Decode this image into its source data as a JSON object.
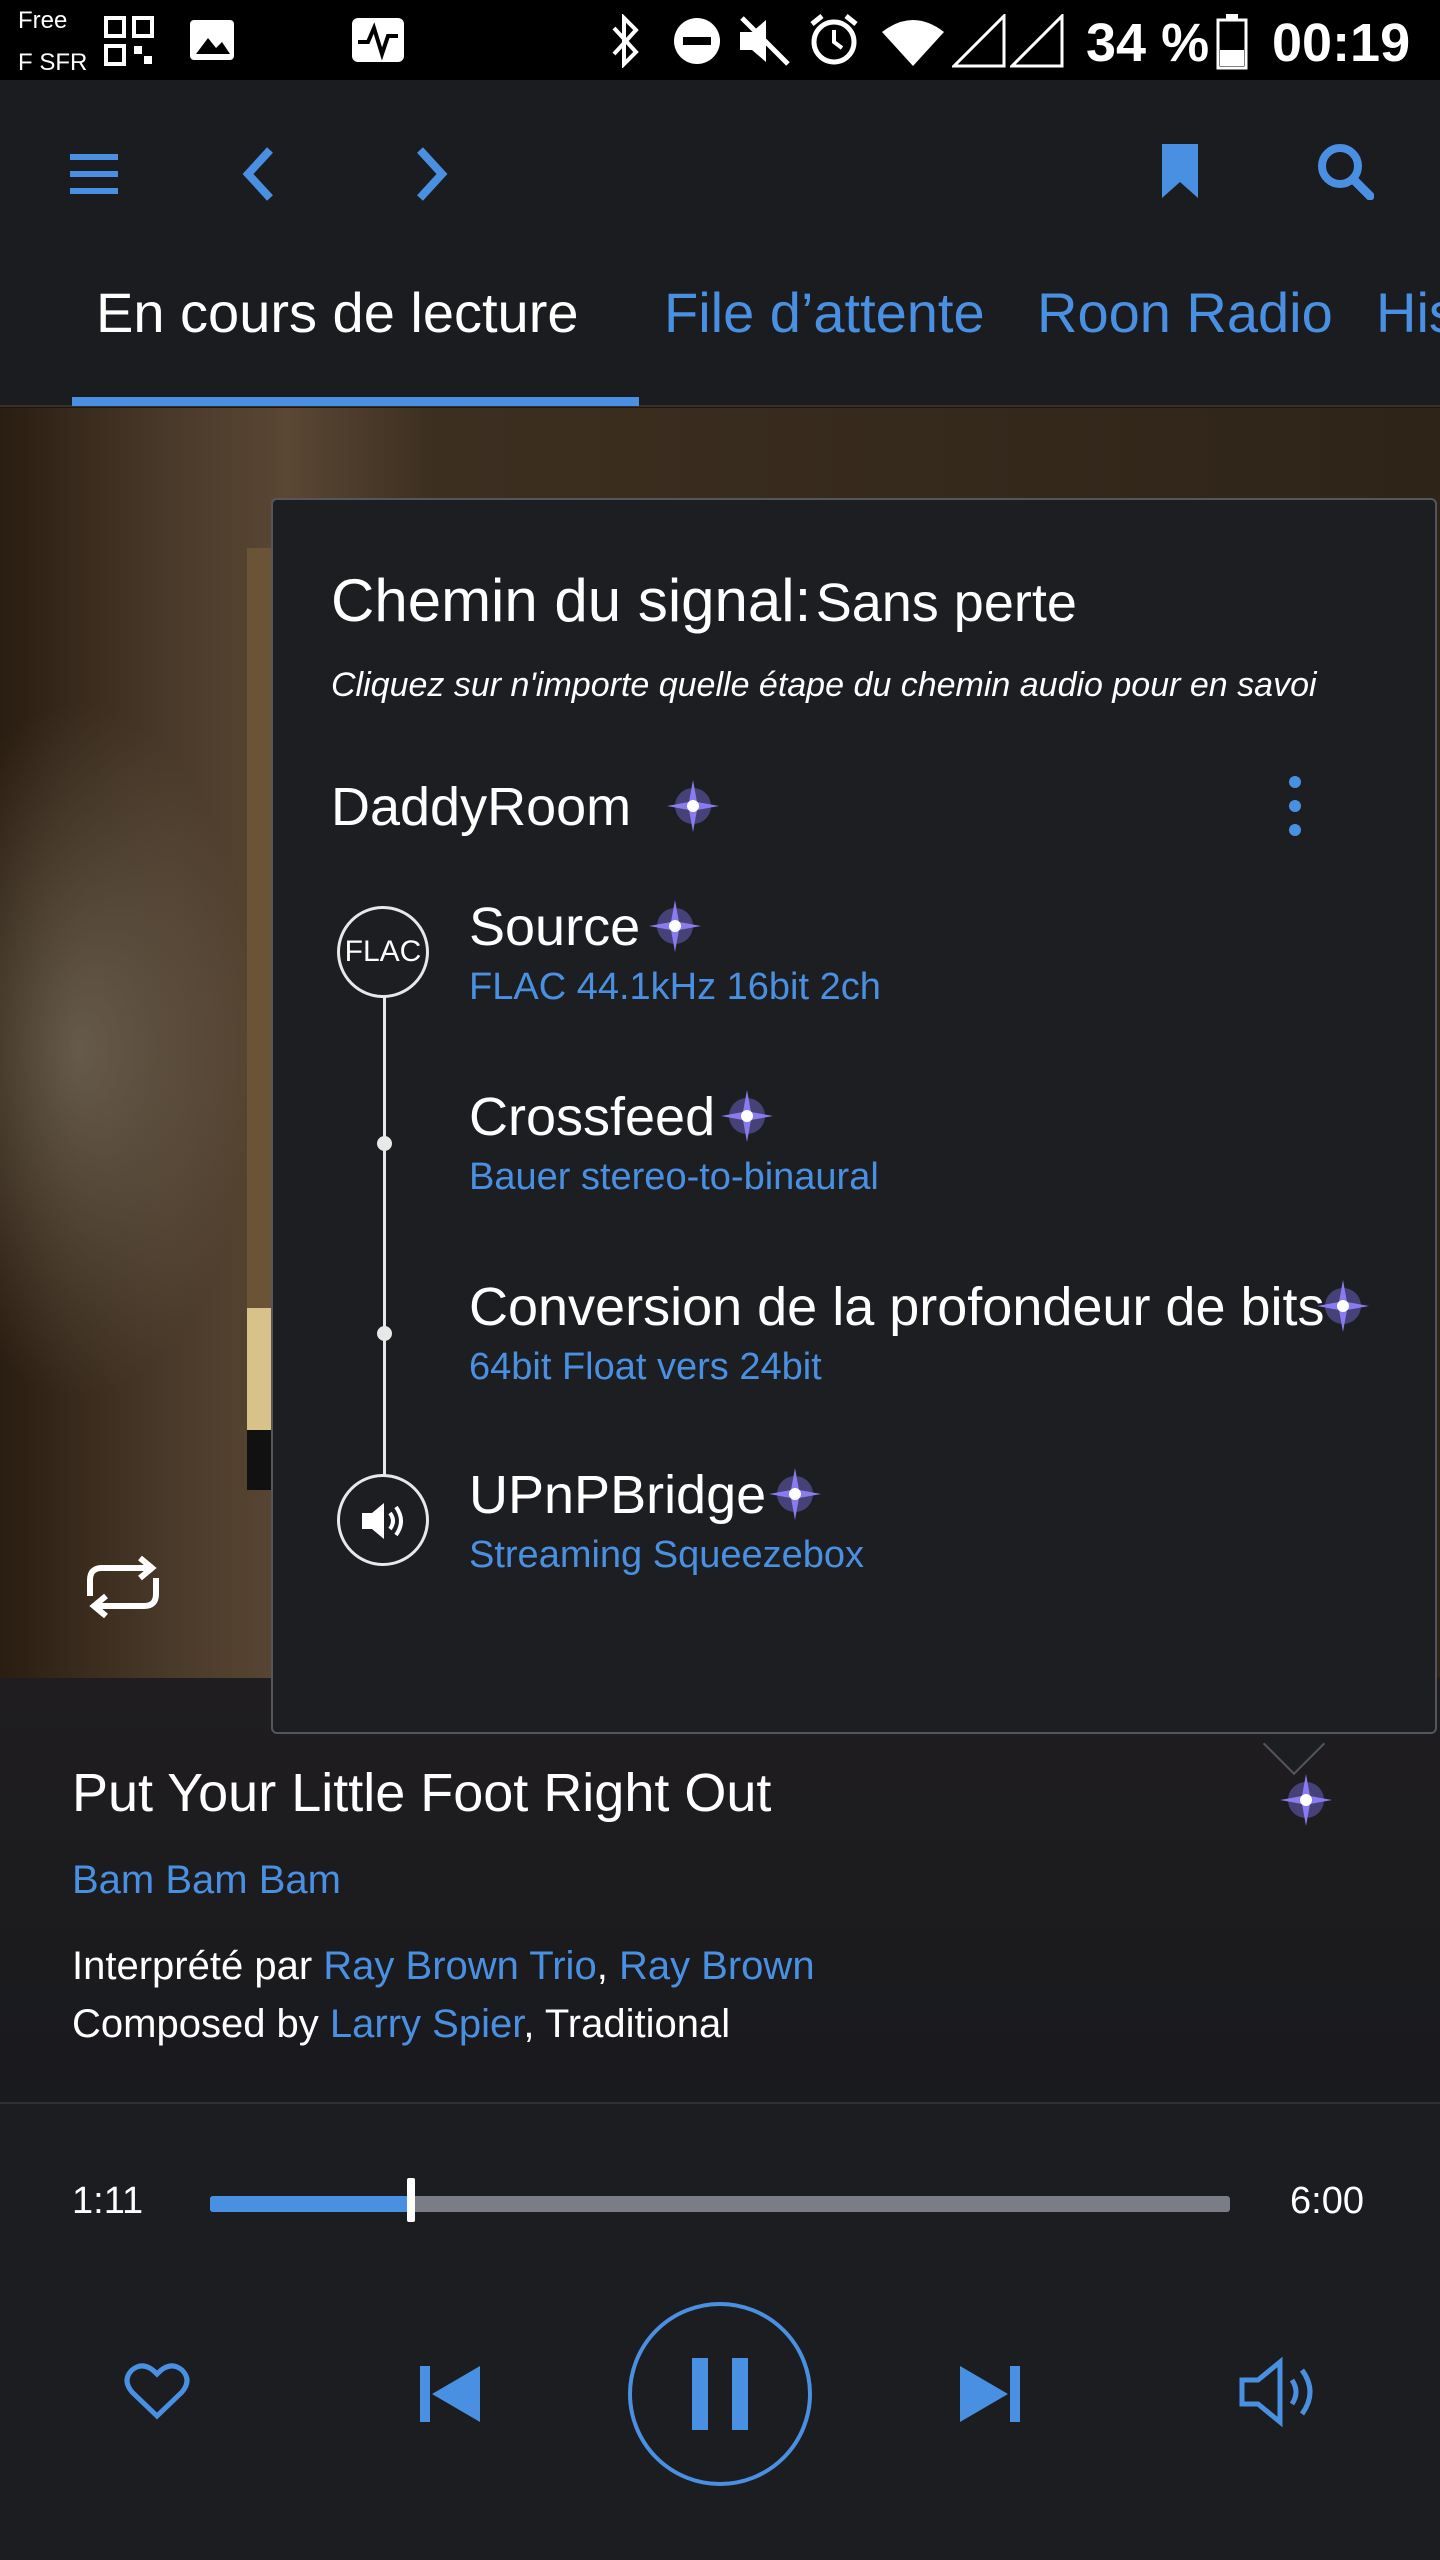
{
  "status_bar": {
    "carrier_line1": "Free",
    "carrier_line2": "F SFR",
    "battery": "34 %",
    "time": "00:19"
  },
  "tabs": [
    {
      "label": "En cours de lecture",
      "active": true
    },
    {
      "label": "File d’attente",
      "active": false
    },
    {
      "label": "Roon Radio",
      "active": false
    },
    {
      "label": "His",
      "active": false
    }
  ],
  "signal_path": {
    "title": "Chemin du signal:",
    "quality": "Sans perte",
    "hint": "Cliquez sur n'importe quelle étape du chemin audio pour en savoi",
    "zone": "DaddyRoom",
    "steps": [
      {
        "title": "Source",
        "detail": "FLAC 44.1kHz 16bit 2ch",
        "badge": "FLAC"
      },
      {
        "title": "Crossfeed",
        "detail": "Bauer stereo-to-binaural"
      },
      {
        "title": "Conversion de la profondeur de bits",
        "detail": "64bit Float vers 24bit"
      },
      {
        "title": "UPnPBridge",
        "detail": "Streaming Squeezebox"
      }
    ]
  },
  "track": {
    "title": "Put Your Little Foot Right Out",
    "album": "Bam Bam Bam",
    "performed_prefix": "Interprété par",
    "performer1": "Ray Brown Trio",
    "separator": ",",
    "performer2": "Ray Brown",
    "composed_prefix": "Composed by",
    "composer1": "Larry Spier",
    "composer_rest": ", Traditional"
  },
  "player": {
    "elapsed": "1:11",
    "duration": "6:00",
    "progress_fraction": 0.197
  },
  "colors": {
    "accent": "#4a90e2",
    "sparkle": "#8a7cf0"
  }
}
